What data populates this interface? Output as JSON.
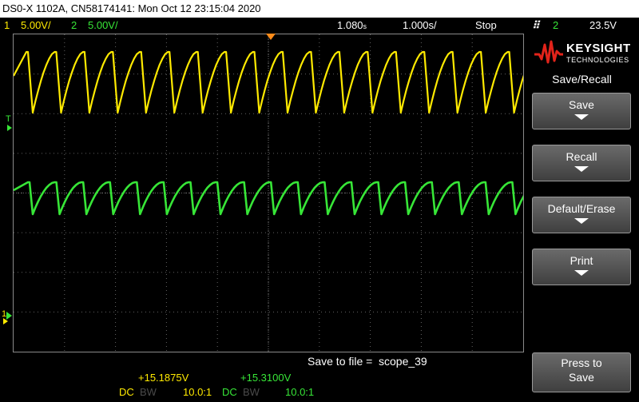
{
  "title_bar": {
    "text": "DS0-X 1102A, CN58174141: Mon Oct 12 23:15:04 2020"
  },
  "status_bar": {
    "ch1_number": "1",
    "ch1_scale": "5.00V/",
    "ch2_number": "2",
    "ch2_scale": "5.00V/",
    "time_delay": "1.080",
    "time_delay_unit": "s",
    "time_scale": "1.000s/",
    "run_state": "Stop",
    "trigger_source": "2",
    "trigger_level": "23.5V"
  },
  "markers": {
    "trigger": "T",
    "ch1": "1",
    "ch2": "2"
  },
  "brand": {
    "name": "KEYSIGHT",
    "subtitle": "TECHNOLOGIES"
  },
  "menu": {
    "title": "Save/Recall",
    "softkeys": [
      {
        "label": "Save"
      },
      {
        "label": "Recall"
      },
      {
        "label": "Default/Erase"
      },
      {
        "label": "Print"
      },
      {
        "label": "Press to",
        "label2": "Save"
      }
    ]
  },
  "save": {
    "label": "Save to file =",
    "filename": "scope_39"
  },
  "measurements": {
    "ch1": {
      "value": "+15.1875V",
      "coupling": "DC",
      "bw": "BW",
      "probe": "10.0:1"
    },
    "ch2": {
      "value": "+15.3100V",
      "coupling": "DC",
      "bw": "BW",
      "probe": "10.0:1"
    }
  },
  "colors": {
    "ch1": "#ffea00",
    "ch2": "#37e637",
    "grid": "#6e6e6e",
    "trigger_marker": "#ff8c1a"
  },
  "waveforms": {
    "ch1": {
      "periods": 18,
      "high_level": 0.93,
      "low_level": 0.93,
      "shape": "sawtooth-rising"
    },
    "ch2": {
      "periods": 19,
      "shape": "sawtooth-rising"
    }
  }
}
